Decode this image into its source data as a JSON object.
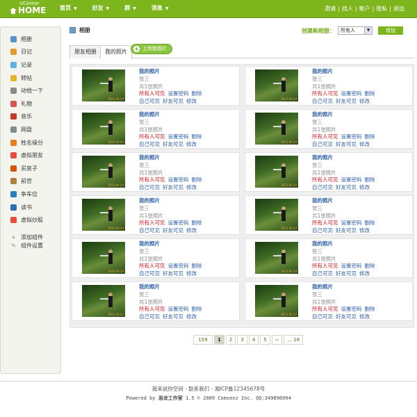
{
  "brand": {
    "top": "UCenter",
    "name": "HOME"
  },
  "nav": [
    {
      "label": "首页"
    },
    {
      "label": "好友"
    },
    {
      "label": "群"
    },
    {
      "label": "消息"
    }
  ],
  "user_nav": [
    "邀请",
    "找人",
    "帐户",
    "隐私",
    "退出"
  ],
  "sidebar": {
    "apps": [
      {
        "label": "相册",
        "icon": "album-icon",
        "color": "#5a92c7"
      },
      {
        "label": "日记",
        "icon": "diary-icon",
        "color": "#e39b2c"
      },
      {
        "label": "记录",
        "icon": "record-icon",
        "color": "#5ab3e0"
      },
      {
        "label": "转帖",
        "icon": "share-icon",
        "color": "#e6b428"
      },
      {
        "label": "动他一下",
        "icon": "poke-icon",
        "color": "#8a8a8a"
      },
      {
        "label": "礼物",
        "icon": "gift-icon",
        "color": "#d9534f"
      },
      {
        "label": "音乐",
        "icon": "music-icon",
        "color": "#c0392b"
      },
      {
        "label": "网盘",
        "icon": "disk-icon",
        "color": "#7f8c8d"
      },
      {
        "label": "姓名缘分",
        "icon": "name-icon",
        "color": "#e67e22"
      },
      {
        "label": "虚拟朋友",
        "icon": "friend-icon",
        "color": "#e74c3c"
      },
      {
        "label": "买房子",
        "icon": "house-icon",
        "color": "#d35400"
      },
      {
        "label": "前世",
        "icon": "past-icon",
        "color": "#b07d3a"
      },
      {
        "label": "争车位",
        "icon": "car-icon",
        "color": "#2980b9"
      },
      {
        "label": "读书",
        "icon": "book-icon",
        "color": "#2c6eb5"
      },
      {
        "label": "虚拟炒股",
        "icon": "stock-icon",
        "color": "#e74c3c"
      }
    ],
    "tools": [
      {
        "label": "添加组件",
        "icon": "add-component-icon"
      },
      {
        "label": "组件设置",
        "icon": "component-settings-icon"
      }
    ]
  },
  "page": {
    "title": "相册"
  },
  "create": {
    "label": "创建新相册：",
    "select_value": "所有人",
    "button": "增加"
  },
  "tabs": [
    {
      "label": "朋友相册",
      "active": false
    },
    {
      "label": "我的照片",
      "active": true
    }
  ],
  "upload_button": "上传新图片",
  "album_text": {
    "title": "我的照片",
    "owner": "张三",
    "count": "共1张照片",
    "vis_all": "所有人可见",
    "set_pwd": "设置密码",
    "delete": "删除",
    "vis_self": "自己可见",
    "vis_friends": "好友可见",
    "edit": "修改",
    "stamp": "2013.06.24"
  },
  "albums": [
    {
      "title": "我的照片",
      "owner": "张三",
      "count": "共1张照片"
    },
    {
      "title": "我的照片",
      "owner": "张三",
      "count": "共1张照片"
    },
    {
      "title": "我的照片",
      "owner": "张三",
      "count": "共1张照片"
    },
    {
      "title": "我的照片",
      "owner": "张三",
      "count": "共1张照片"
    },
    {
      "title": "我的照片",
      "owner": "张三",
      "count": "共1张照片"
    },
    {
      "title": "我的照片",
      "owner": "张三",
      "count": "共1张照片"
    },
    {
      "title": "我的照片",
      "owner": "张三",
      "count": "共1张照片"
    },
    {
      "title": "我的照片",
      "owner": "张三",
      "count": "共1张照片"
    },
    {
      "title": "我的照片",
      "owner": "张三",
      "count": "共1张照片"
    },
    {
      "title": "我的照片",
      "owner": "张三",
      "count": "共1张照片"
    },
    {
      "title": "我的照片",
      "owner": "张三",
      "count": "共1张照片"
    },
    {
      "title": "我的照片",
      "owner": "张三",
      "count": "共1张照片"
    }
  ],
  "pagination": {
    "total": "159",
    "pages": [
      "1",
      "2",
      "3",
      "4",
      "5",
      "››",
      "... 16"
    ],
    "current": "1"
  },
  "footer": {
    "line1": "我来说你空间 - 联系我们 - 湘ICP备12345678号",
    "line2_prefix": "Powered by",
    "line2_brand": "浴龙工作室",
    "line2_suffix": "1.5 © 2009 Comsenz Inc. QQ:349896094"
  },
  "colors": {
    "accent": "#7cb51c",
    "link": "#2d5fa8",
    "alert": "#d8161e"
  }
}
